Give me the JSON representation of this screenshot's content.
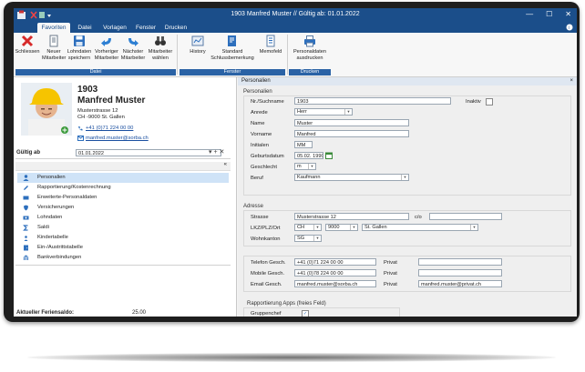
{
  "window": {
    "title": "1903 Manfred Muster // Gültig ab: 01.01.2022"
  },
  "tabs": [
    "Favoriten",
    "Datei",
    "Vorlagen",
    "Fenster",
    "Drucken"
  ],
  "ribbon": {
    "buttons": [
      {
        "l1": "Schliessen",
        "l2": ""
      },
      {
        "l1": "Neuer",
        "l2": "Mitarbeiter"
      },
      {
        "l1": "Lohndaten",
        "l2": "speichern"
      },
      {
        "l1": "Vorheriger",
        "l2": "Mitarbeiter"
      },
      {
        "l1": "Nächster",
        "l2": "Mitarbeiter"
      },
      {
        "l1": "Mitarbeiter",
        "l2": "wählen"
      },
      {
        "l1": "History",
        "l2": ""
      },
      {
        "l1": "Standard",
        "l2": "Schlussbemerkung"
      },
      {
        "l1": "Memofeld",
        "l2": ""
      },
      {
        "l1": "Personaldaten",
        "l2": "ausdrucken"
      }
    ],
    "groups": [
      "Datei",
      "Fenster",
      "Drucken"
    ]
  },
  "employee": {
    "number": "1903",
    "name": "Manfred Muster",
    "street": "Musterstrasse 12",
    "city": "CH -9000 St. Gallen",
    "phone": "+41 (0)71 224 00 00",
    "email": "manfred.muster@sorba.ch"
  },
  "valid_from": {
    "label": "Gültig ab",
    "value": "01.01.2022"
  },
  "nav": [
    "Personalien",
    "Rapportierung/Kostenrechnung",
    "Erweiterte-Personaldaten",
    "Versicherungen",
    "Lohndaten",
    "Saldi",
    "Kindertabelle",
    "Ein-/Austrittstabelle",
    "Bankverbindungen"
  ],
  "footer": {
    "label": "Aktueller Feriensaldo:",
    "value": "25.00"
  },
  "panel": {
    "title": "Personalien",
    "section": "Personalien"
  },
  "form": {
    "nr_label": "Nr./Suchname",
    "nr": "1903",
    "inaktiv_label": "Inaktiv",
    "anrede_label": "Anrede",
    "anrede": "Herr",
    "name_label": "Name",
    "name": "Muster",
    "vorname_label": "Vorname",
    "vorname": "Manfred",
    "initialen_label": "Initialen",
    "initialen": "MM",
    "geburtsdatum_label": "Geburtsdatum",
    "geburtsdatum": "05.02. 1990",
    "geschlecht_label": "Geschlecht",
    "geschlecht": "m",
    "beruf_label": "Beruf",
    "beruf": "Kaufmann",
    "adresse_section": "Adresse",
    "strasse_label": "Strasse",
    "strasse": "Musterstrasse 12",
    "co_label": "c/o",
    "lkz_label": "LKZ/PLZ/Ort",
    "lkz": "CH",
    "plz": "9000",
    "ort": "St. Gallen",
    "wohnkanton_label": "Wohnkanton",
    "wohnkanton": "SG",
    "tel_label": "Telefon Gesch.",
    "tel": "+41 (0)71 224 00 00",
    "mobile_label": "Mobile Gesch.",
    "mobile": "+41 (0)78 224 00 00",
    "email_label": "Email Gesch.",
    "email": "manfred.muster@sorba.ch",
    "privat_label": "Privat",
    "email_privat": "manfred.muster@privat.ch",
    "apps_section": "Rapportierung Apps (freies Feld)",
    "gruppenchef_label": "Gruppenchef"
  },
  "colors": {
    "titlebar": "#1b4e8a",
    "accent": "#2a62a5",
    "selection": "#cfe3f7"
  }
}
